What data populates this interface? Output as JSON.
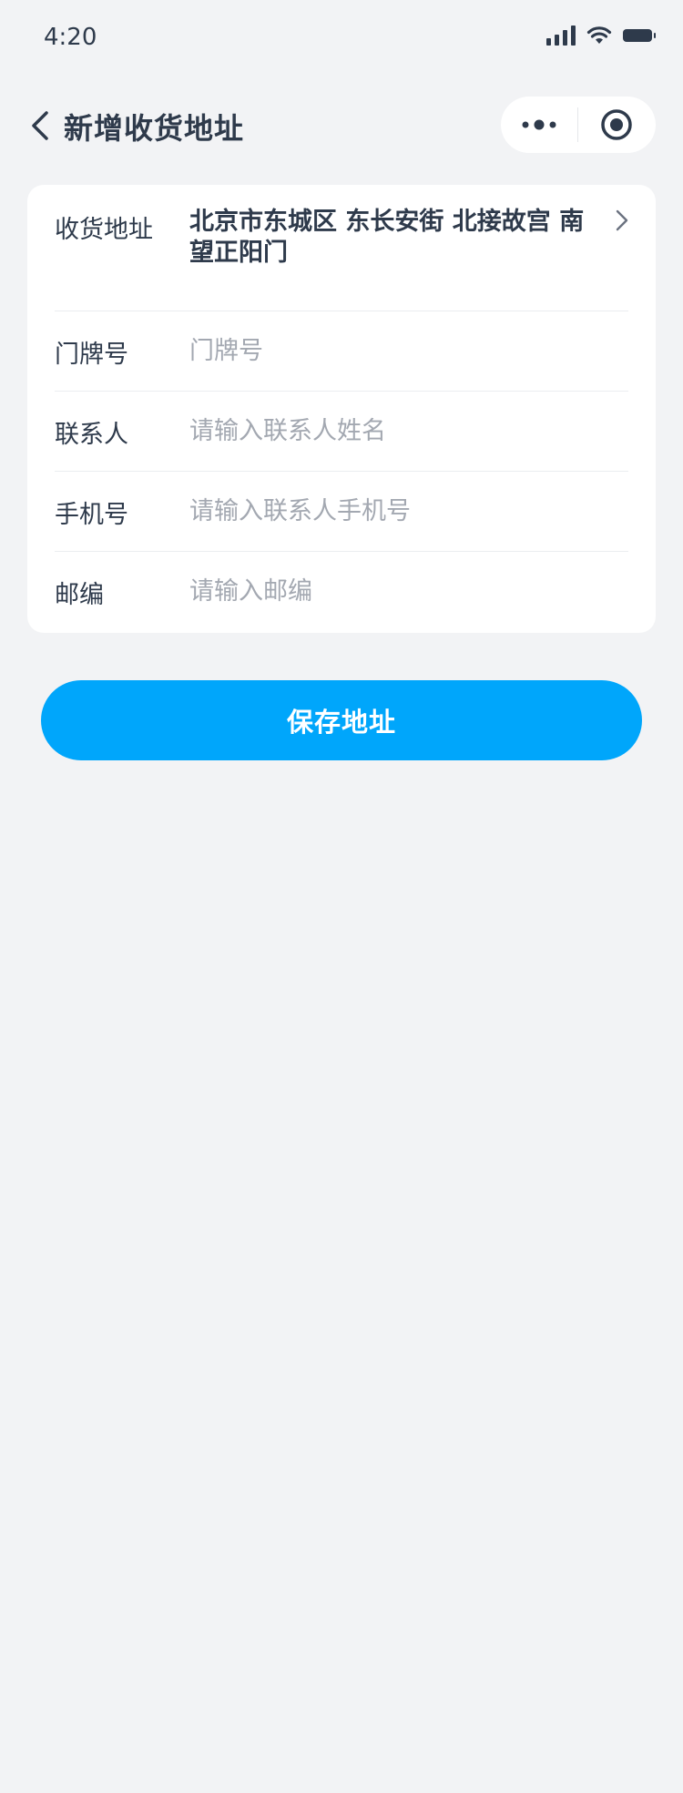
{
  "status_bar": {
    "time": "4:20",
    "icons": [
      "signal-icon",
      "wifi-icon",
      "battery-icon"
    ]
  },
  "nav": {
    "title": "新增收货地址",
    "back_icon": "chevron-left-icon",
    "more_icon": "more-dots-icon",
    "close_icon": "target-circle-icon"
  },
  "form": {
    "address": {
      "label": "收货地址",
      "value": "北京市东城区  东长安街 北接故宫 南望正阳门"
    },
    "door_number": {
      "label": "门牌号",
      "placeholder": "门牌号",
      "value": ""
    },
    "contact": {
      "label": "联系人",
      "placeholder": "请输入联系人姓名",
      "value": ""
    },
    "phone": {
      "label": "手机号",
      "placeholder": "请输入联系人手机号",
      "value": ""
    },
    "postcode": {
      "label": "邮编",
      "placeholder": "请输入邮编",
      "value": ""
    }
  },
  "save_button": {
    "label": "保存地址"
  },
  "colors": {
    "background": "#F2F3F5",
    "card": "#FFFFFF",
    "primary": "#00A6FB",
    "text": "#2E3A4B",
    "placeholder": "#A3A8B1",
    "divider": "#EBEDF0"
  }
}
